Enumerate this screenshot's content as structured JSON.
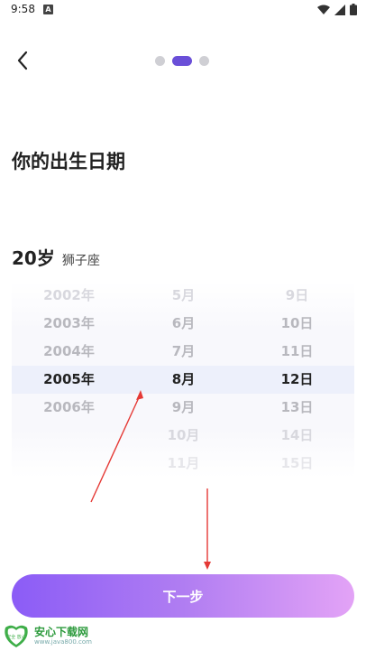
{
  "status_bar": {
    "time": "9:58",
    "notification_icon_letter": "A",
    "icons": [
      "wifi-icon",
      "signal-icon",
      "battery-icon"
    ]
  },
  "header": {
    "back_icon": "chevron-left-icon",
    "pager": {
      "total": 3,
      "active_index": 1
    }
  },
  "page_title": "你的出生日期",
  "age": "20岁",
  "zodiac": "狮子座",
  "picker": {
    "years": [
      "2002年",
      "2003年",
      "2004年",
      "2005年",
      "2006年",
      "",
      ""
    ],
    "months": [
      "5月",
      "6月",
      "7月",
      "8月",
      "9月",
      "10月",
      "11月"
    ],
    "days": [
      "9日",
      "10日",
      "11日",
      "12日",
      "13日",
      "14日",
      "15日"
    ],
    "selected_row_index": 3
  },
  "next_button": "下一步",
  "watermark": {
    "logo_text": "安全 放心",
    "title": "安心下载网",
    "url": "www.java800.com"
  },
  "colors": {
    "accent": "#6a4fd8",
    "button_gradient_start": "#8b5cf6",
    "button_gradient_end": "#e3a3f6",
    "annotation_arrow": "#e53935"
  }
}
